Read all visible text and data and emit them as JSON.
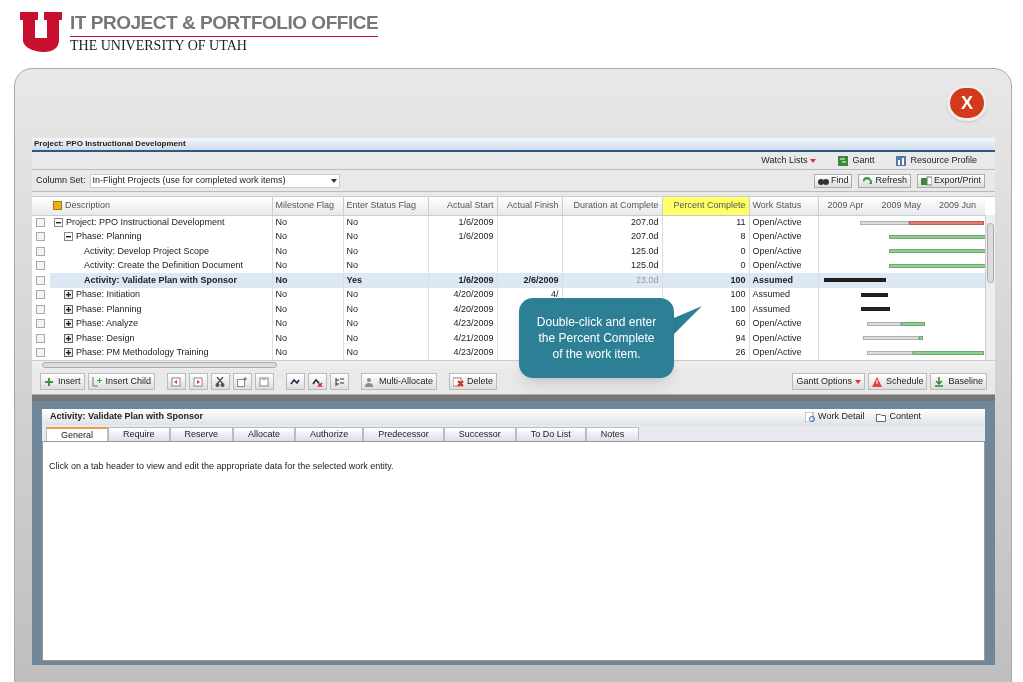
{
  "header": {
    "office": "IT PROJECT & PORTFOLIO OFFICE",
    "university": "THE UNIVERSITY OF UTAH",
    "close": "X"
  },
  "project_title": "Project: PPO Instructional Development",
  "top_links": [
    {
      "label": "Watch Lists",
      "kind": "menu"
    },
    {
      "label": "Gantt",
      "kind": "gantt"
    },
    {
      "label": "Resource Profile",
      "kind": "resource"
    }
  ],
  "column_set": {
    "label": "Column Set:",
    "value": "In-Flight Projects (use for completed work items)"
  },
  "actions": [
    {
      "label": "Find",
      "kind": "find"
    },
    {
      "label": "Refresh",
      "kind": "refresh"
    },
    {
      "label": "Export/Print",
      "kind": "export"
    }
  ],
  "table": {
    "columns": [
      {
        "label": "Description",
        "highlighted": false
      },
      {
        "label": "Milestone Flag",
        "highlighted": false
      },
      {
        "label": "Enter Status Flag",
        "highlighted": false
      },
      {
        "label": "Actual Start",
        "highlighted": false
      },
      {
        "label": "Actual Finish",
        "highlighted": false
      },
      {
        "label": "Duration at Complete",
        "highlighted": false
      },
      {
        "label": "Percent Complete",
        "highlighted": true
      },
      {
        "label": "Work Status",
        "highlighted": false
      }
    ],
    "gantt_months": [
      "2009 Apr",
      "2009 May",
      "2009 Jun"
    ],
    "rows": [
      {
        "description": "Project: PPO Instructional Development",
        "expanded": true,
        "checked": false,
        "selected": false,
        "milestone": "No",
        "enter_status": "No",
        "actual_start": "1/6/2009",
        "duration": "207.0d",
        "percent_complete": "11",
        "work_status": "Open/Active",
        "children": [
          {
            "description": "Phase: Planning",
            "expanded": true,
            "checked": false,
            "selected": false,
            "milestone": "No",
            "enter_status": "No",
            "actual_start": "1/6/2009",
            "duration": "207.0d",
            "percent_complete": "8",
            "work_status": "Open/Active",
            "children": [
              {
                "description": "Activity: Develop Project Scope",
                "checked": false,
                "selected": false,
                "milestone": "No",
                "enter_status": "No",
                "duration": "125.0d",
                "percent_complete": "0",
                "work_status": "Open/Active"
              },
              {
                "description": "Activity: Create the Definition Document",
                "checked": false,
                "selected": false,
                "milestone": "No",
                "enter_status": "No",
                "duration": "125.0d",
                "percent_complete": "0",
                "work_status": "Open/Active"
              },
              {
                "description": "Activity: Validate Plan with Sponsor",
                "checked": false,
                "selected": true,
                "milestone": "No",
                "enter_status": "Yes",
                "actual_start": "1/6/2009",
                "actual_finish": "2/6/2009",
                "duration": "23.0d",
                "percent_complete": "100",
                "work_status": "Assumed"
              }
            ]
          },
          {
            "description": "Phase: Initiation",
            "expanded": false,
            "checked": false,
            "selected": false,
            "milestone": "No",
            "enter_status": "No",
            "actual_start": "4/20/2009",
            "actual_finish": "4/",
            "percent_complete": "100",
            "work_status": "Assumed"
          },
          {
            "description": "Phase: Planning",
            "expanded": false,
            "checked": false,
            "selected": false,
            "milestone": "No",
            "enter_status": "No",
            "actual_start": "4/20/2009",
            "percent_complete": "100",
            "work_status": "Assumed"
          },
          {
            "description": "Phase: Analyze",
            "expanded": false,
            "checked": false,
            "selected": false,
            "milestone": "No",
            "enter_status": "No",
            "actual_start": "4/23/2009",
            "percent_complete": "60",
            "work_status": "Open/Active"
          },
          {
            "description": "Phase: Design",
            "expanded": false,
            "checked": false,
            "selected": false,
            "milestone": "No",
            "enter_status": "No",
            "actual_start": "4/21/2009",
            "percent_complete": "94",
            "work_status": "Open/Active"
          },
          {
            "description": "Phase: PM Methodology Training",
            "expanded": false,
            "checked": false,
            "selected": false,
            "milestone": "No",
            "enter_status": "No",
            "actual_start": "4/23/2009",
            "percent_complete": "26",
            "work_status": "Open/Active"
          }
        ]
      }
    ]
  },
  "toolbar_left": [
    {
      "label": "Insert",
      "kind": "insert"
    },
    {
      "label": "Insert Child",
      "kind": "insert_child"
    },
    {
      "kind": "indent_left"
    },
    {
      "kind": "indent_right"
    },
    {
      "kind": "cut"
    },
    {
      "kind": "copy"
    },
    {
      "kind": "paste"
    },
    {
      "kind": "link"
    },
    {
      "kind": "unlink"
    },
    {
      "kind": "outline"
    },
    {
      "label": "Multi-Allocate",
      "kind": "allocate"
    },
    {
      "label": "Delete",
      "kind": "delete"
    }
  ],
  "toolbar_right": [
    {
      "label": "Gantt Options",
      "kind": "menu"
    },
    {
      "label": "Schedule",
      "kind": "schedule"
    },
    {
      "label": "Baseline",
      "kind": "baseline"
    }
  ],
  "callout": "Double-click and enter the Percent Complete of the work item.",
  "detail": {
    "title": "Activity: Validate Plan with Sponsor",
    "links": [
      {
        "label": "Work Detail",
        "kind": "detail"
      },
      {
        "label": "Content",
        "kind": "folder"
      }
    ],
    "tabs": [
      {
        "label": "General",
        "selected": true
      },
      {
        "label": "Require",
        "selected": false
      },
      {
        "label": "Reserve",
        "selected": false
      },
      {
        "label": "Allocate",
        "selected": false
      },
      {
        "label": "Authorize",
        "selected": false
      },
      {
        "label": "Predecessor",
        "selected": false
      },
      {
        "label": "Successor",
        "selected": false
      },
      {
        "label": "To Do List",
        "selected": false
      },
      {
        "label": "Notes",
        "selected": false
      }
    ],
    "message": "Click on a tab header to view and edit the appropriate data for the selected work entity."
  }
}
